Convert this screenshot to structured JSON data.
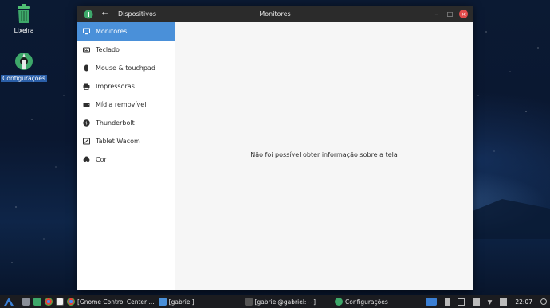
{
  "desktop": {
    "icons": [
      {
        "label": "Lixeira"
      },
      {
        "label": "Configurações"
      }
    ]
  },
  "window": {
    "header_left_title": "Dispositivos",
    "header_center_title": "Monitores",
    "controls": {
      "minimize": "–",
      "maximize": "□",
      "close": "×"
    }
  },
  "sidebar": {
    "items": [
      {
        "label": "Monitores",
        "icon": "display-icon",
        "active": true
      },
      {
        "label": "Teclado",
        "icon": "keyboard-icon"
      },
      {
        "label": "Mouse & touchpad",
        "icon": "mouse-icon"
      },
      {
        "label": "Impressoras",
        "icon": "printer-icon"
      },
      {
        "label": "Mídia removível",
        "icon": "removable-media-icon"
      },
      {
        "label": "Thunderbolt",
        "icon": "thunderbolt-icon"
      },
      {
        "label": "Tablet Wacom",
        "icon": "tablet-icon"
      },
      {
        "label": "Cor",
        "icon": "color-icon"
      }
    ]
  },
  "content": {
    "message": "Não foi possível obter informação sobre a tela"
  },
  "taskbar": {
    "items": [
      {
        "label": "[Gnome Control Center ..."
      },
      {
        "label": "[gabriel]"
      },
      {
        "label": "[gabriel@gabriel: ~]"
      },
      {
        "label": "Configurações"
      }
    ],
    "clock": "22:07"
  },
  "colors": {
    "accent": "#4a90d9",
    "titlebar": "#2b2b2b",
    "taskbar": "#1b1c20",
    "brand_green": "#3ea86a"
  }
}
